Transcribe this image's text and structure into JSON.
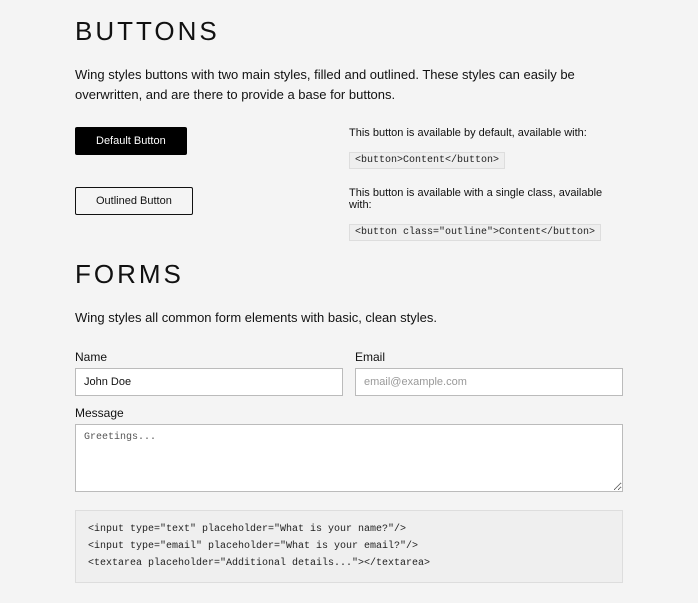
{
  "buttons": {
    "heading": "BUTTONS",
    "lead": "Wing styles buttons with two main styles, filled and outlined. These styles can easily be overwritten, and are there to provide a base for buttons.",
    "default": {
      "label": "Default Button",
      "desc": "This button is available by default, available with:",
      "code": "<button>Content</button>"
    },
    "outlined": {
      "label": "Outlined Button",
      "desc": "This button is available with a single class, available with:",
      "code": "<button class=\"outline\">Content</button>"
    }
  },
  "forms": {
    "heading": "FORMS",
    "lead": "Wing styles all common form elements with basic, clean styles.",
    "name": {
      "label": "Name",
      "value": "John Doe"
    },
    "email": {
      "label": "Email",
      "placeholder": "email@example.com"
    },
    "message": {
      "label": "Message",
      "value": "Greetings..."
    },
    "codeblock": "<input type=\"text\" placeholder=\"What is your name?\"/>\n<input type=\"email\" placeholder=\"What is your email?\"/>\n<textarea placeholder=\"Additional details...\"></textarea>"
  }
}
